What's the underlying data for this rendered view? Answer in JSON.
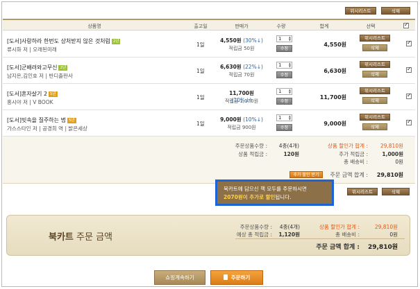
{
  "top_buttons": {
    "wishlist": "위시리스트",
    "delete": "삭제"
  },
  "columns": [
    "상품명",
    "출고일",
    "판매가",
    "수량",
    "합계",
    "선택"
  ],
  "rows": [
    {
      "title": "[도서]사랑하라 한번도 상처받지 않은 것처럼",
      "badge": "2년",
      "badge_color": "#9cc23a",
      "author": "류시화 저 | 오래된미래",
      "days": "1일",
      "price": "4,550원",
      "pct": "(30%↓)",
      "points": "적립금 50원",
      "qty": "1",
      "total": "4,550원",
      "wish": "위시리스트",
      "del": "삭제",
      "update": "수정"
    },
    {
      "title": "[도서]군배려와고무신",
      "badge": "2년",
      "badge_color": "#9cc23a",
      "author": "남지은,김인호 저 | 반디출판사",
      "days": "1일",
      "price": "6,630원",
      "pct": "(22%↓)",
      "points": "적립금 70원",
      "qty": "1",
      "total": "6,630원",
      "wish": "위시리스트",
      "del": "삭제",
      "update": "수정"
    },
    {
      "title": "[도서]혼자살기 2",
      "badge": "5년",
      "badge_color": "#e0a020",
      "author": "홍시야 저 | V BOOK",
      "days": "1일",
      "price": "11,700원",
      "pct": "(10%↓)",
      "points": "적립금 1,170원",
      "qty": "1",
      "total": "11,700원",
      "wish": "위시리스트",
      "del": "삭제",
      "update": "수정"
    },
    {
      "title": "[도서]빗속을 질주하는 법",
      "badge": "5년",
      "badge_color": "#e0a020",
      "author": "가스스타인 저 | 공경희 역 | 밝은세상",
      "days": "1일",
      "price": "9,000원",
      "pct": "(10%↓)",
      "points": "적립금 900원",
      "qty": "1",
      "total": "9,000원",
      "wish": "위시리스트",
      "del": "삭제",
      "update": "수정"
    }
  ],
  "summary": {
    "order_count_label": "주문상품수량 :",
    "order_count": "4종(4개)",
    "points_label": "상품 적립금 :",
    "points": "120원",
    "discount_label": "상품 할인가 합계 :",
    "discount": "29,810원",
    "extra_points_label": "추가 적립금 :",
    "extra_points": "1,000원",
    "shipping_label": "총 배송비 :",
    "shipping": "0원",
    "extra_discount_button": "추가 할인 받기",
    "order_total_label": "주문 금액 합계 :",
    "order_total": "29,810원"
  },
  "mid_buttons": {
    "wishlist": "위시리스트",
    "delete": "삭제"
  },
  "notice": {
    "line1": "북카트에 담으신 책 모두를 주문하시면",
    "amount": "2070원이 추가로 할인",
    "line2_suffix": "됩니다."
  },
  "cart": {
    "title_bold": "북카트",
    "title_rest": " 주문 금액",
    "count_label": "주문상품수량 :",
    "count": "4종(4개)",
    "points_label": "예상 총 적립금 :",
    "points": "1,120원",
    "discount_label": "상품 할인가 합계 :",
    "discount": "29,810원",
    "shipping_label": "총 배송비 :",
    "shipping": "0원",
    "total_label": "주문 금액 합계 :",
    "total": "29,810원"
  },
  "bottom": {
    "continue": "쇼핑계속하기",
    "order": "주문하기"
  }
}
